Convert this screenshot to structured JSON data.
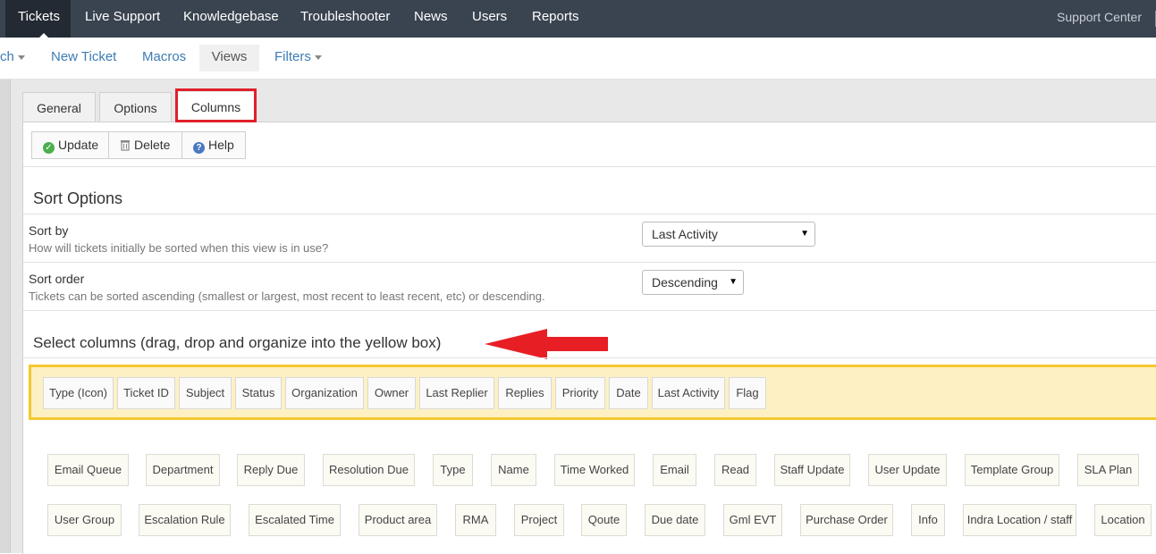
{
  "topnav": {
    "items": [
      "Tickets",
      "Live Support",
      "Knowledgebase",
      "Troubleshooter",
      "News",
      "Users",
      "Reports"
    ],
    "right": "Support Center"
  },
  "subnav": {
    "items": [
      "ch",
      "New Ticket",
      "Macros",
      "Views",
      "Filters"
    ]
  },
  "tabs": [
    "General",
    "Options",
    "Columns"
  ],
  "toolbar": {
    "update": "Update",
    "delete": "Delete",
    "help": "Help"
  },
  "sort_options": {
    "title": "Sort Options",
    "sort_by": {
      "label": "Sort by",
      "desc": "How will tickets initially be sorted when this view is in use?",
      "value": "Last Activity"
    },
    "sort_order": {
      "label": "Sort order",
      "desc": "Tickets can be sorted ascending (smallest or largest, most recent to least recent, etc) or descending.",
      "value": "Descending"
    }
  },
  "columns": {
    "title": "Select columns (drag, drop and organize into the yellow box)",
    "selected": [
      "Type (Icon)",
      "Ticket ID",
      "Subject",
      "Status",
      "Organization",
      "Owner",
      "Last Replier",
      "Replies",
      "Priority",
      "Date",
      "Last Activity",
      "Flag"
    ],
    "available_row1": [
      "Email Queue",
      "Department",
      "Reply Due",
      "Resolution Due",
      "Type",
      "Name",
      "Time Worked",
      "Email",
      "Read",
      "Staff Update",
      "User Update",
      "Template Group",
      "SLA Plan"
    ],
    "available_row2": [
      "User Group",
      "Escalation Rule",
      "Escalated Time",
      "Product area",
      "RMA",
      "Project",
      "Qoute",
      "Due date",
      "Gml EVT",
      "Purchase Order",
      "Info",
      "Indra Location / staff",
      "Location"
    ]
  },
  "colors": {
    "highlight_red": "#e0202a",
    "yellow_border": "#f5c72f",
    "yellow_fill": "#fdf1c3",
    "nav_bg": "#3a4350"
  }
}
